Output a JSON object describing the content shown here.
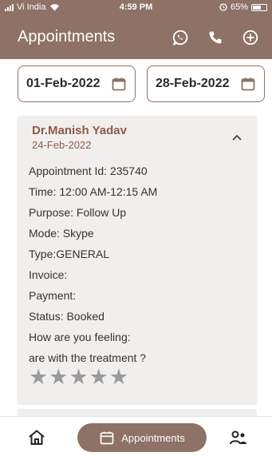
{
  "status_bar": {
    "carrier": "Vi India",
    "time": "4:59 PM",
    "battery": "65%",
    "battery_level": 0.65
  },
  "header": {
    "title": "Appointments",
    "icons": [
      "whatsapp-icon",
      "phone-icon",
      "add-icon"
    ]
  },
  "filters": {
    "from_date": "01-Feb-2022",
    "to_date": "28-Feb-2022"
  },
  "appointment": {
    "doctor": "Dr.Manish Yadav",
    "date": "24-Feb-2022",
    "details": [
      "Appointment Id: 235740",
      "Time: 12:00 AM-12:15 AM",
      "Purpose: Follow Up",
      "Mode: Skype",
      "Type:GENERAL",
      "Invoice:",
      "Payment:",
      "Status: Booked",
      "How are you feeling:",
      "are with the treatment ?"
    ],
    "rating": {
      "value": 0,
      "max": 5
    }
  },
  "nav": {
    "home_icon": "home-icon",
    "active_label": "Appointments",
    "people_icon": "people-icon"
  },
  "colors": {
    "primary": "#8d7265",
    "accent_text": "#8d5c47",
    "card_bg": "#f1efee",
    "star": "#9b9b9b"
  }
}
